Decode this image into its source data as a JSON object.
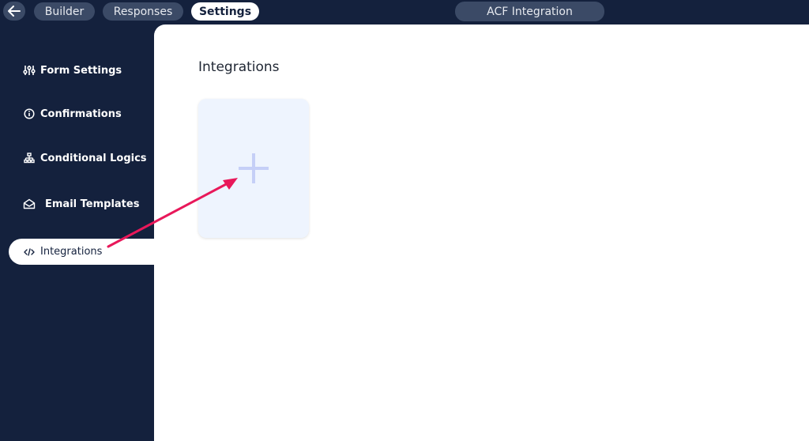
{
  "topbar": {
    "tabs": [
      {
        "label": "Builder"
      },
      {
        "label": "Responses"
      },
      {
        "label": "Settings"
      }
    ],
    "form_title": "ACF Integration"
  },
  "sidebar": {
    "items": [
      {
        "label": "Form Settings",
        "icon": "sliders-icon"
      },
      {
        "label": "Confirmations",
        "icon": "info-icon"
      },
      {
        "label": "Conditional Logics",
        "icon": "sitemap-icon"
      },
      {
        "label": "Email Templates",
        "icon": "envelope-open-icon"
      },
      {
        "label": "Integrations",
        "icon": "code-icon",
        "active": true
      }
    ]
  },
  "main": {
    "title": "Integrations",
    "add_card_icon": "plus-icon"
  },
  "colors": {
    "navy": "#14213d",
    "pill": "#3b4a66",
    "card": "#eef4fe",
    "plus": "#c5cff7",
    "arrow": "#e8185a"
  }
}
